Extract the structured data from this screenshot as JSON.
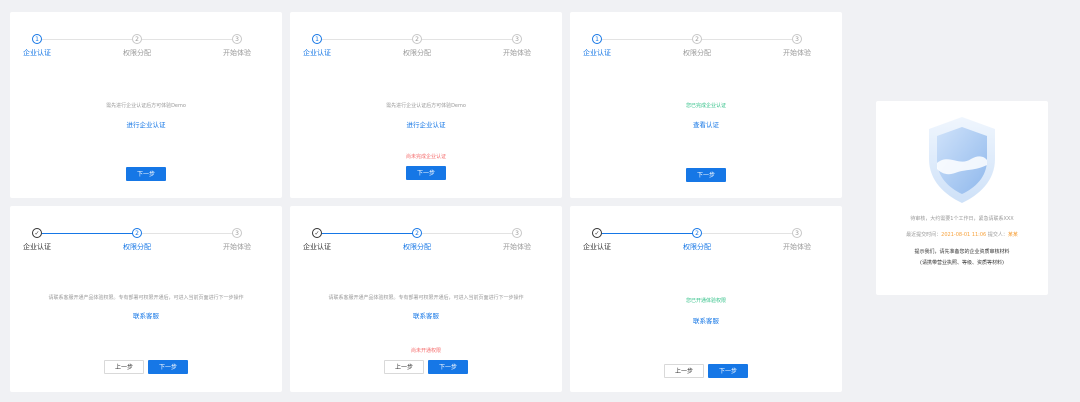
{
  "steps": {
    "s1": "企业认证",
    "s2": "权限分配",
    "s3": "开始体验"
  },
  "step_numbers": {
    "n1": "1",
    "n2": "2",
    "n3": "3",
    "check": "✓"
  },
  "card1": {
    "desc": "需先进行企业认证后方可体验Demo",
    "link": "进行企业认证",
    "next": "下一步"
  },
  "card2": {
    "desc": "需先进行企业认证后方可体验Demo",
    "link": "进行企业认证",
    "warn": "尚未完成企业认证",
    "next": "下一步"
  },
  "card3": {
    "desc": "您已完成企业认证",
    "link": "查看认证",
    "next": "下一步"
  },
  "card4": {
    "desc": "请联系客服开通产品体验权限。专有部署可权限开通后，可进入当前页面进行下一步操作",
    "link": "联系客服",
    "prev": "上一步",
    "next": "下一步"
  },
  "card5": {
    "desc": "请联系客服开通产品体验权限。专有部署可权限开通后，可进入当前页面进行下一步操作",
    "link": "联系客服",
    "warn": "尚未开通权限",
    "prev": "上一步",
    "next": "下一步"
  },
  "card6": {
    "desc": "您已开通体验权限",
    "link": "联系客服",
    "prev": "上一步",
    "next": "下一步"
  },
  "review": {
    "line1": "待审核，大约需要1个工作日，紧急请联系XXX",
    "line2_prefix": "最近提交时间：",
    "line2_time": "2021-08-01 11:06",
    "line2_mid": " 提交人：",
    "line2_user": "某某",
    "line3": "提示我们，请先准备您的企业资质审核材料",
    "line4": "(请携带营业执照、等级、资质等材料)"
  },
  "colors": {
    "primary": "#1677e6",
    "success": "#35c28a",
    "danger": "#f56c6c",
    "warning": "#f7a23c"
  }
}
